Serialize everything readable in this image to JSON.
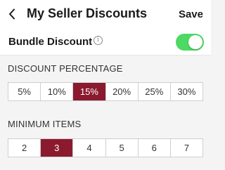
{
  "header": {
    "title": "My Seller Discounts",
    "save_label": "Save"
  },
  "bundle": {
    "label": "Bundle Discount",
    "info_glyph": "i",
    "enabled": true
  },
  "discount": {
    "label": "DISCOUNT PERCENTAGE",
    "options": [
      "5%",
      "10%",
      "15%",
      "20%",
      "25%",
      "30%"
    ],
    "selected": "15%"
  },
  "minimum": {
    "label": "MINIMUM ITEMS",
    "options": [
      "2",
      "3",
      "4",
      "5",
      "6",
      "7"
    ],
    "selected": "3"
  },
  "colors": {
    "accent": "#8b1a2e",
    "toggle_on": "#4cd964"
  },
  "icons": {
    "back": "chevron-left-icon",
    "info": "info-icon"
  }
}
